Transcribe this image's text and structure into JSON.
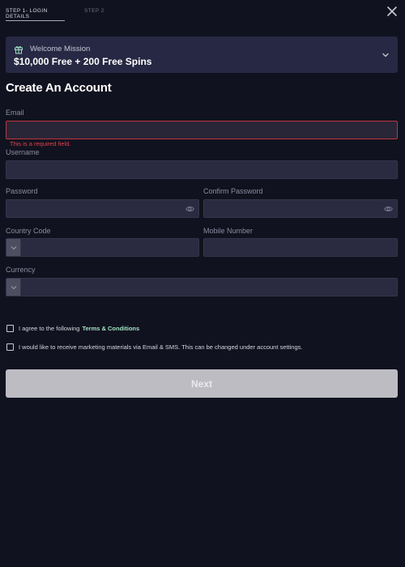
{
  "steps": [
    {
      "label": "STEP 1- LOGIN DETAILS"
    },
    {
      "label": "STEP 2"
    }
  ],
  "mission": {
    "label": "Welcome Mission",
    "title": "$10,000 Free + 200 Free Spins"
  },
  "form": {
    "heading": "Create An Account",
    "email": {
      "label": "Email",
      "value": "",
      "error": "This is a required field."
    },
    "username": {
      "label": "Username",
      "value": ""
    },
    "password": {
      "label": "Password",
      "value": ""
    },
    "confirm_password": {
      "label": "Confirm Password",
      "value": ""
    },
    "country_code": {
      "label": "Country Code",
      "value": ""
    },
    "mobile_number": {
      "label": "Mobile Number",
      "value": ""
    },
    "currency": {
      "label": "Currency",
      "value": ""
    },
    "agree_prefix": "I agree to the following",
    "terms_link": "Terms & Conditions",
    "marketing_text": "I would like to receive marketing materials via Email & SMS. This can be changed under account settings.",
    "next_label": "Next"
  },
  "colors": {
    "background": "#11121f",
    "field": "#2a2b40",
    "error": "#e0414b",
    "link": "#9fe3c3",
    "button_disabled": "#bdbcc2"
  },
  "icons": [
    "close-icon",
    "gift-icon",
    "chevron-down-icon",
    "eye-icon"
  ]
}
